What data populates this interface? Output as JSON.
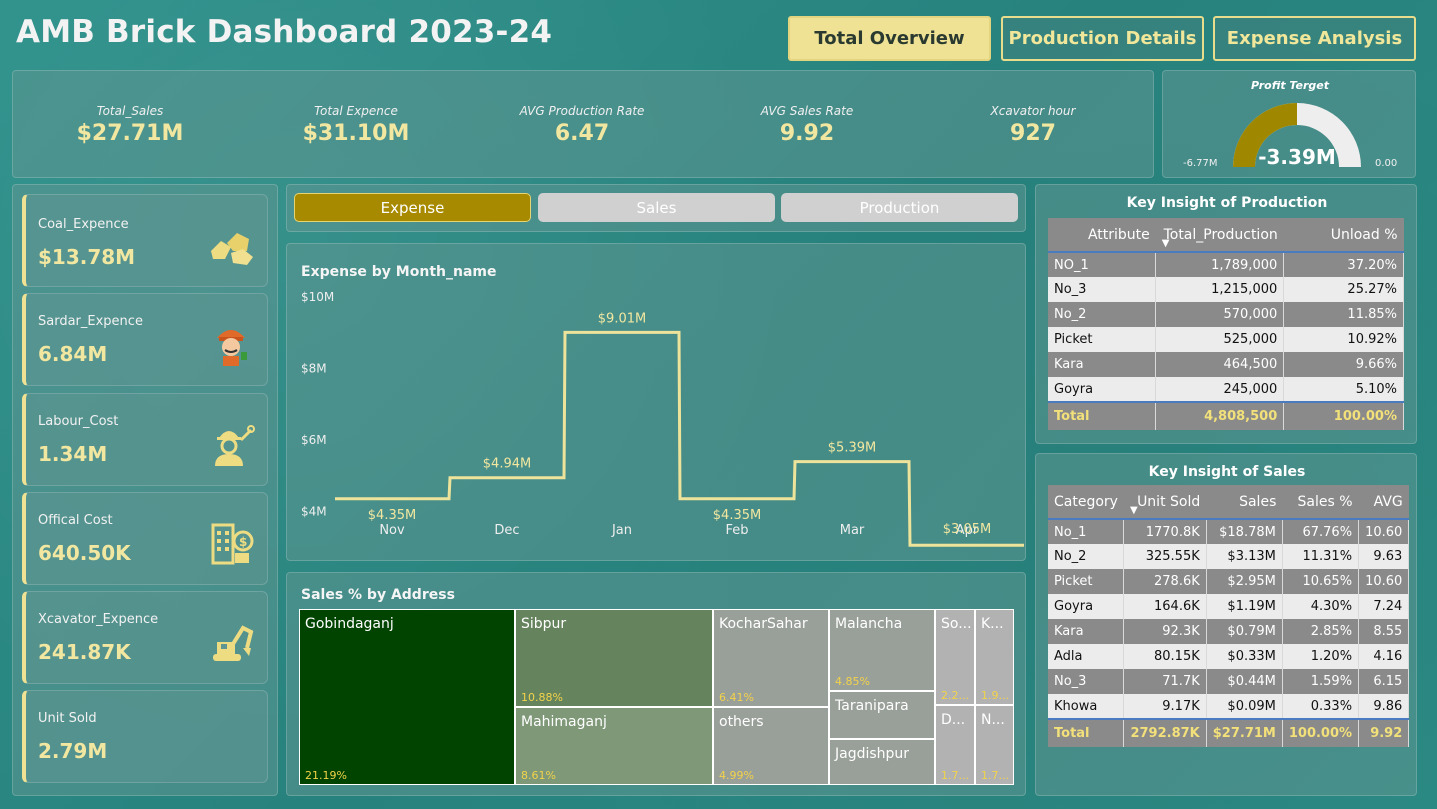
{
  "header": {
    "title": "AMB Brick Dashboard 2023-24"
  },
  "nav": [
    {
      "label": "Total Overview"
    },
    {
      "label": "Production Details"
    },
    {
      "label": "Expense Analysis"
    }
  ],
  "kpis": [
    {
      "label": "Total_Sales",
      "value": "$27.71M"
    },
    {
      "label": "Total Expence",
      "value": "$31.10M"
    },
    {
      "label": "AVG Production Rate",
      "value": "6.47"
    },
    {
      "label": "AVG Sales Rate",
      "value": "9.92"
    },
    {
      "label": "Xcavator hour",
      "value": "927"
    }
  ],
  "gauge": {
    "title": "Profit Terget",
    "value": "-3.39M",
    "min": "-6.77M",
    "max": "0.00",
    "fraction": 0.5,
    "colors": {
      "fill": "#a08700",
      "track": "#eeeeee"
    }
  },
  "cards": [
    {
      "label": "Coal_Expence",
      "value": "$13.78M",
      "icon": "coal-icon"
    },
    {
      "label": "Sardar_Expence",
      "value": "6.84M",
      "icon": "worker-icon"
    },
    {
      "label": "Labour_Cost",
      "value": "1.34M",
      "icon": "labour-icon"
    },
    {
      "label": "Offical Cost",
      "value": "640.50K",
      "icon": "office-icon"
    },
    {
      "label": "Xcavator_Expence",
      "value": "241.87K",
      "icon": "excavator-icon"
    },
    {
      "label": "Unit Sold",
      "value": "2.79M",
      "icon": ""
    }
  ],
  "tabs": [
    {
      "label": "Expense"
    },
    {
      "label": "Sales"
    },
    {
      "label": "Production"
    }
  ],
  "chart_data": {
    "type": "line",
    "title": "Expense by Month_name",
    "categories": [
      "Nov",
      "Dec",
      "Jan",
      "Feb",
      "Mar",
      "Apr"
    ],
    "values": [
      4.35,
      4.94,
      9.01,
      4.35,
      5.39,
      3.05
    ],
    "data_labels": [
      "$4.35M",
      "$4.94M",
      "$9.01M",
      "$4.35M",
      "$5.39M",
      "$3.05M"
    ],
    "y_ticks": [
      "$4M",
      "$6M",
      "$8M",
      "$10M"
    ],
    "y_tick_values": [
      4,
      6,
      8,
      10
    ],
    "ylim": [
      3,
      10
    ],
    "step": true,
    "grid": false,
    "color": "#eee39a"
  },
  "treemap": {
    "title": "Sales % by Address",
    "tiles": [
      {
        "name": "Gobindaganj",
        "pct": "21.19%"
      },
      {
        "name": "Sibpur",
        "pct": "10.88%"
      },
      {
        "name": "Mahimaganj",
        "pct": "8.61%"
      },
      {
        "name": "KocharSahar",
        "pct": "6.41%"
      },
      {
        "name": "others",
        "pct": "4.99%"
      },
      {
        "name": "Malancha",
        "pct": "4.85%"
      },
      {
        "name": "Taranipara",
        "pct": ""
      },
      {
        "name": "Jagdishpur",
        "pct": ""
      },
      {
        "name": "So...",
        "pct": "2.2..."
      },
      {
        "name": "K...",
        "pct": "1.9..."
      },
      {
        "name": "D...",
        "pct": "1.7..."
      },
      {
        "name": "N...",
        "pct": "1.7..."
      }
    ],
    "colors": {
      "dark": "#004400",
      "mid": "#65835c",
      "light": "#7e9878",
      "grey": "#999f99",
      "pale": "#b2b2b2"
    }
  },
  "production_table": {
    "title": "Key Insight of Production",
    "headers": [
      "Attribute",
      "Total_Production",
      "Unload %"
    ],
    "rows": [
      [
        "NO_1",
        "1,789,000",
        "37.20%"
      ],
      [
        "No_3",
        "1,215,000",
        "25.27%"
      ],
      [
        "No_2",
        "570,000",
        "11.85%"
      ],
      [
        "Picket",
        "525,000",
        "10.92%"
      ],
      [
        "Kara",
        "464,500",
        "9.66%"
      ],
      [
        "Goyra",
        "245,000",
        "5.10%"
      ]
    ],
    "total": [
      "Total",
      "4,808,500",
      "100.00%"
    ]
  },
  "sales_table": {
    "title": "Key Insight of Sales",
    "headers": [
      "Category",
      "Unit Sold",
      "Sales",
      "Sales %",
      "AVG"
    ],
    "rows": [
      [
        "No_1",
        "1770.8K",
        "$18.78M",
        "67.76%",
        "10.60"
      ],
      [
        "No_2",
        "325.55K",
        "$3.13M",
        "11.31%",
        "9.63"
      ],
      [
        "Picket",
        "278.6K",
        "$2.95M",
        "10.65%",
        "10.60"
      ],
      [
        "Goyra",
        "164.6K",
        "$1.19M",
        "4.30%",
        "7.24"
      ],
      [
        "Kara",
        "92.3K",
        "$0.79M",
        "2.85%",
        "8.55"
      ],
      [
        "Adla",
        "80.15K",
        "$0.33M",
        "1.20%",
        "4.16"
      ],
      [
        "No_3",
        "71.7K",
        "$0.44M",
        "1.59%",
        "6.15"
      ],
      [
        "Khowa",
        "9.17K",
        "$0.09M",
        "0.33%",
        "9.86"
      ]
    ],
    "total": [
      "Total",
      "2792.87K",
      "$27.71M",
      "100.00%",
      "9.92"
    ]
  }
}
